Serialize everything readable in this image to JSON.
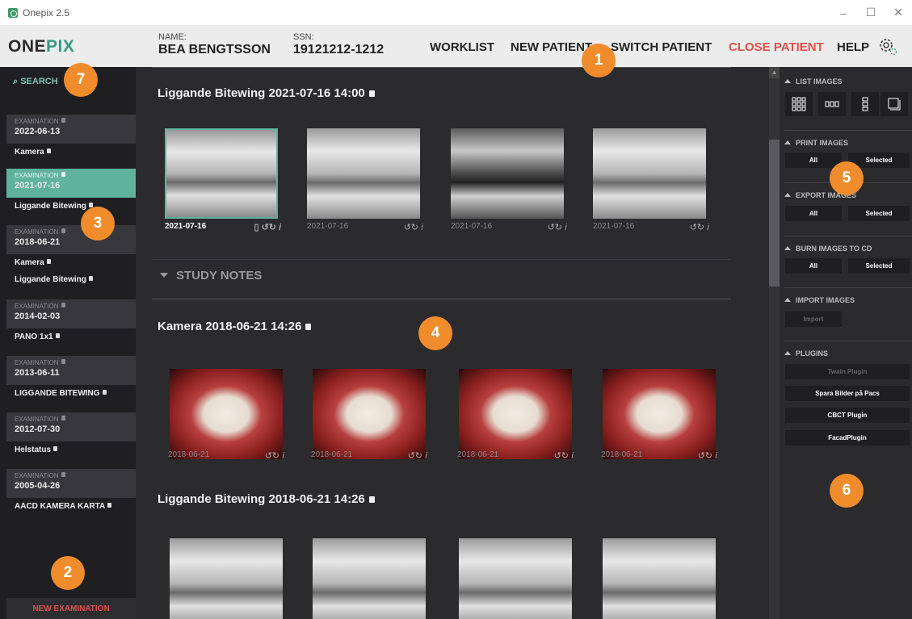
{
  "window": {
    "title": "Onepix 2.5",
    "min": "–",
    "max": "☐",
    "close": "✕"
  },
  "header": {
    "logo_first": "O",
    "logo_ne": "NE",
    "logo_rest": "PIX",
    "name_label": "NAME:",
    "name_value": "BEA BENGTSSON",
    "ssn_label": "SSN:",
    "ssn_value": "19121212-1212",
    "nav": {
      "worklist": "WORKLIST",
      "new_patient": "NEW PATIENT",
      "switch_patient": "SWITCH PATIENT",
      "close_patient": "CLOSE PATIENT",
      "help": "HELP"
    }
  },
  "sidebar": {
    "search": "SEARCH",
    "exam_label": "EXAMINATION",
    "exams": [
      {
        "date": "2022-06-13",
        "items": [
          "Kamera"
        ]
      },
      {
        "date": "2021-07-16",
        "items": [
          "Liggande Bitewing"
        ]
      },
      {
        "date": "2018-06-21",
        "items": [
          "Kamera",
          "Liggande Bitewing"
        ]
      },
      {
        "date": "2014-02-03",
        "items": [
          "PANO 1x1"
        ]
      },
      {
        "date": "2013-06-11",
        "items": [
          "LIGGANDE BITEWING"
        ]
      },
      {
        "date": "2012-07-30",
        "items": [
          "Helstatus"
        ]
      },
      {
        "date": "2005-04-26",
        "items": [
          "AACD KAMERA KARTA"
        ]
      }
    ],
    "new_examination": "NEW EXAMINATION"
  },
  "main": {
    "series1": {
      "title": "Liggande Bitewing 2021-07-16 14:00",
      "dates": [
        "2021-07-16",
        "2021-07-16",
        "2021-07-16",
        "2021-07-16"
      ]
    },
    "study_notes": "STUDY NOTES",
    "series2": {
      "title": "Kamera  2018-06-21 14:26",
      "dates": [
        "2018-06-21",
        "2018-06-21",
        "2018-06-21",
        "2018-06-21"
      ]
    },
    "series3": {
      "title": "Liggande Bitewing 2018-06-21 14:26"
    }
  },
  "right_panel": {
    "list_images": "LIST IMAGES",
    "print_images": "PRINT IMAGES",
    "export_images": "EXPORT IMAGES",
    "burn_images": "BURN IMAGES TO CD",
    "import_images": "IMPORT IMAGES",
    "plugins": "PLUGINS",
    "all": "All",
    "selected": "Selected",
    "import": "Import",
    "plugin_items": [
      "Twain Plugin",
      "Spara Bilder på Pacs",
      "CBCT Plugin",
      "FacadPlugin"
    ]
  },
  "callouts": [
    "1",
    "2",
    "3",
    "4",
    "5",
    "6",
    "7"
  ],
  "colors": {
    "accent": "#5fb39a",
    "close": "#e0504a",
    "callout": "#f08c2c"
  }
}
